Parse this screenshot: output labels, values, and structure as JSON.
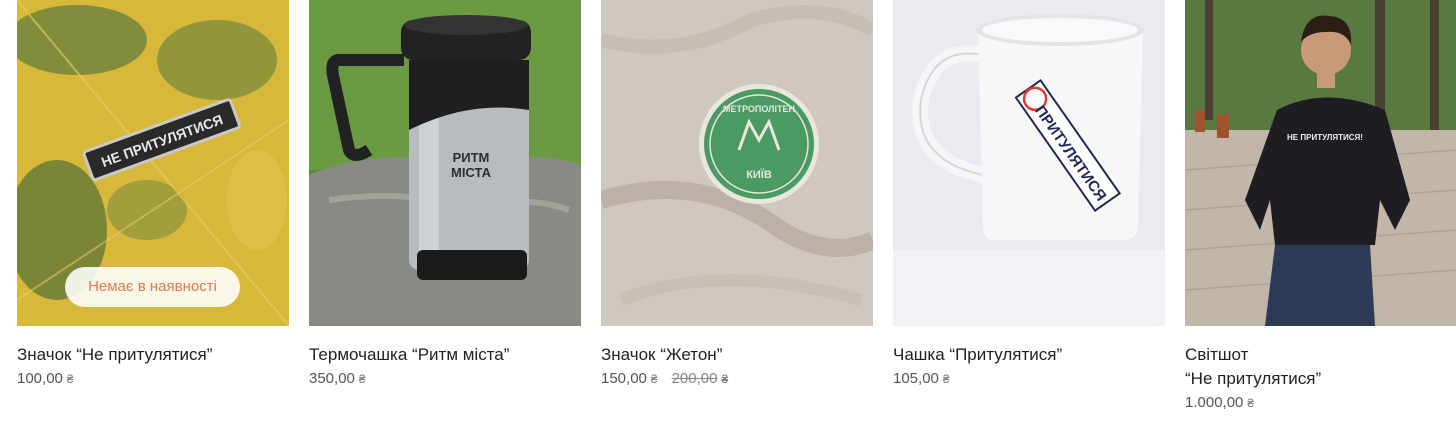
{
  "products": [
    {
      "name": "Значок “Не притулятися”",
      "price": "100,00",
      "currency": "₴",
      "badge": "Немає в наявності",
      "image_text": "НЕ ПРИТУЛЯТИСЯ"
    },
    {
      "name": "Термочашка “Ритм міста”",
      "price": "350,00",
      "currency": "₴",
      "image_text_1": "РИТМ",
      "image_text_2": "МІСТА"
    },
    {
      "name": "Значок “Жетон”",
      "price": "150,00",
      "currency": "₴",
      "old_price": "200,00",
      "old_currency": "₴",
      "image_text_1": "МЕТРОПОЛІТЕН",
      "image_text_2": "КИЇВ"
    },
    {
      "name": "Чашка “Притулятися”",
      "price": "105,00",
      "currency": "₴",
      "image_text": "ПРИТУЛЯТИСЯ"
    },
    {
      "name_line1": "Світшот",
      "name_line2": "“Не притулятися”",
      "price": "1.000,00",
      "currency": "₴",
      "image_text": "НЕ ПРИТУЛЯТИСЯ!"
    }
  ]
}
